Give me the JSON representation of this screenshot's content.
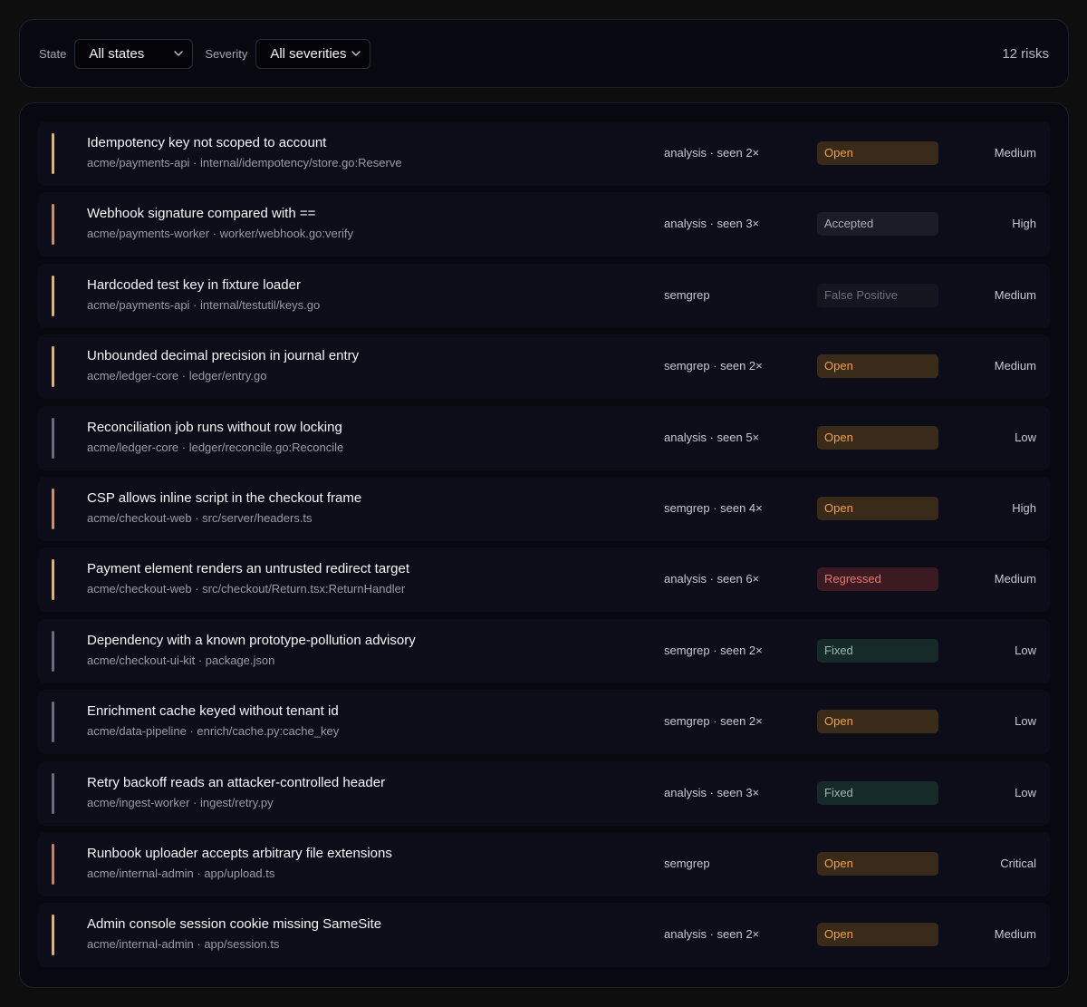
{
  "filters": {
    "state_label": "State",
    "state_value": "All states",
    "severity_label": "Severity",
    "severity_value": "All severities",
    "count_text": "12 risks"
  },
  "status_styles": {
    "Open": {
      "bg": "#3a2a1a",
      "fg": "#f0a14a"
    },
    "Accepted": {
      "bg": "#1c1c28",
      "fg": "#b0b0bc"
    },
    "False Positive": {
      "bg": "#151520",
      "fg": "#6e6e7c"
    },
    "Regressed": {
      "bg": "#3c1a22",
      "fg": "#e8766a"
    },
    "Fixed": {
      "bg": "#162a2a",
      "fg": "#9fb8b4"
    }
  },
  "severity_colors": {
    "Critical": "#e0784a",
    "High": "#e08a52",
    "Medium": "#f0b24a",
    "Low": "#6a6a80"
  },
  "risks": [
    {
      "title": "Idempotency key not scoped to account",
      "path": "acme/payments-api · internal/idempotency/store.go:Reserve",
      "source": "analysis · seen 2×",
      "status": "Open",
      "severity": "Medium"
    },
    {
      "title": "Webhook signature compared with ==",
      "path": "acme/payments-worker · worker/webhook.go:verify",
      "source": "analysis · seen 3×",
      "status": "Accepted",
      "severity": "High"
    },
    {
      "title": "Hardcoded test key in fixture loader",
      "path": "acme/payments-api · internal/testutil/keys.go",
      "source": "semgrep",
      "status": "False Positive",
      "severity": "Medium"
    },
    {
      "title": "Unbounded decimal precision in journal entry",
      "path": "acme/ledger-core · ledger/entry.go",
      "source": "semgrep · seen 2×",
      "status": "Open",
      "severity": "Medium"
    },
    {
      "title": "Reconciliation job runs without row locking",
      "path": "acme/ledger-core · ledger/reconcile.go:Reconcile",
      "source": "analysis · seen 5×",
      "status": "Open",
      "severity": "Low"
    },
    {
      "title": "CSP allows inline script in the checkout frame",
      "path": "acme/checkout-web · src/server/headers.ts",
      "source": "semgrep · seen 4×",
      "status": "Open",
      "severity": "High"
    },
    {
      "title": "Payment element renders an untrusted redirect target",
      "path": "acme/checkout-web · src/checkout/Return.tsx:ReturnHandler",
      "source": "analysis · seen 6×",
      "status": "Regressed",
      "severity": "Medium"
    },
    {
      "title": "Dependency with a known prototype-pollution advisory",
      "path": "acme/checkout-ui-kit · package.json",
      "source": "semgrep · seen 2×",
      "status": "Fixed",
      "severity": "Low"
    },
    {
      "title": "Enrichment cache keyed without tenant id",
      "path": "acme/data-pipeline · enrich/cache.py:cache_key",
      "source": "semgrep · seen 2×",
      "status": "Open",
      "severity": "Low"
    },
    {
      "title": "Retry backoff reads an attacker-controlled header",
      "path": "acme/ingest-worker · ingest/retry.py",
      "source": "analysis · seen 3×",
      "status": "Fixed",
      "severity": "Low"
    },
    {
      "title": "Runbook uploader accepts arbitrary file extensions",
      "path": "acme/internal-admin · app/upload.ts",
      "source": "semgrep",
      "status": "Open",
      "severity": "Critical"
    },
    {
      "title": "Admin console session cookie missing SameSite",
      "path": "acme/internal-admin · app/session.ts",
      "source": "analysis · seen 2×",
      "status": "Open",
      "severity": "Medium"
    }
  ]
}
